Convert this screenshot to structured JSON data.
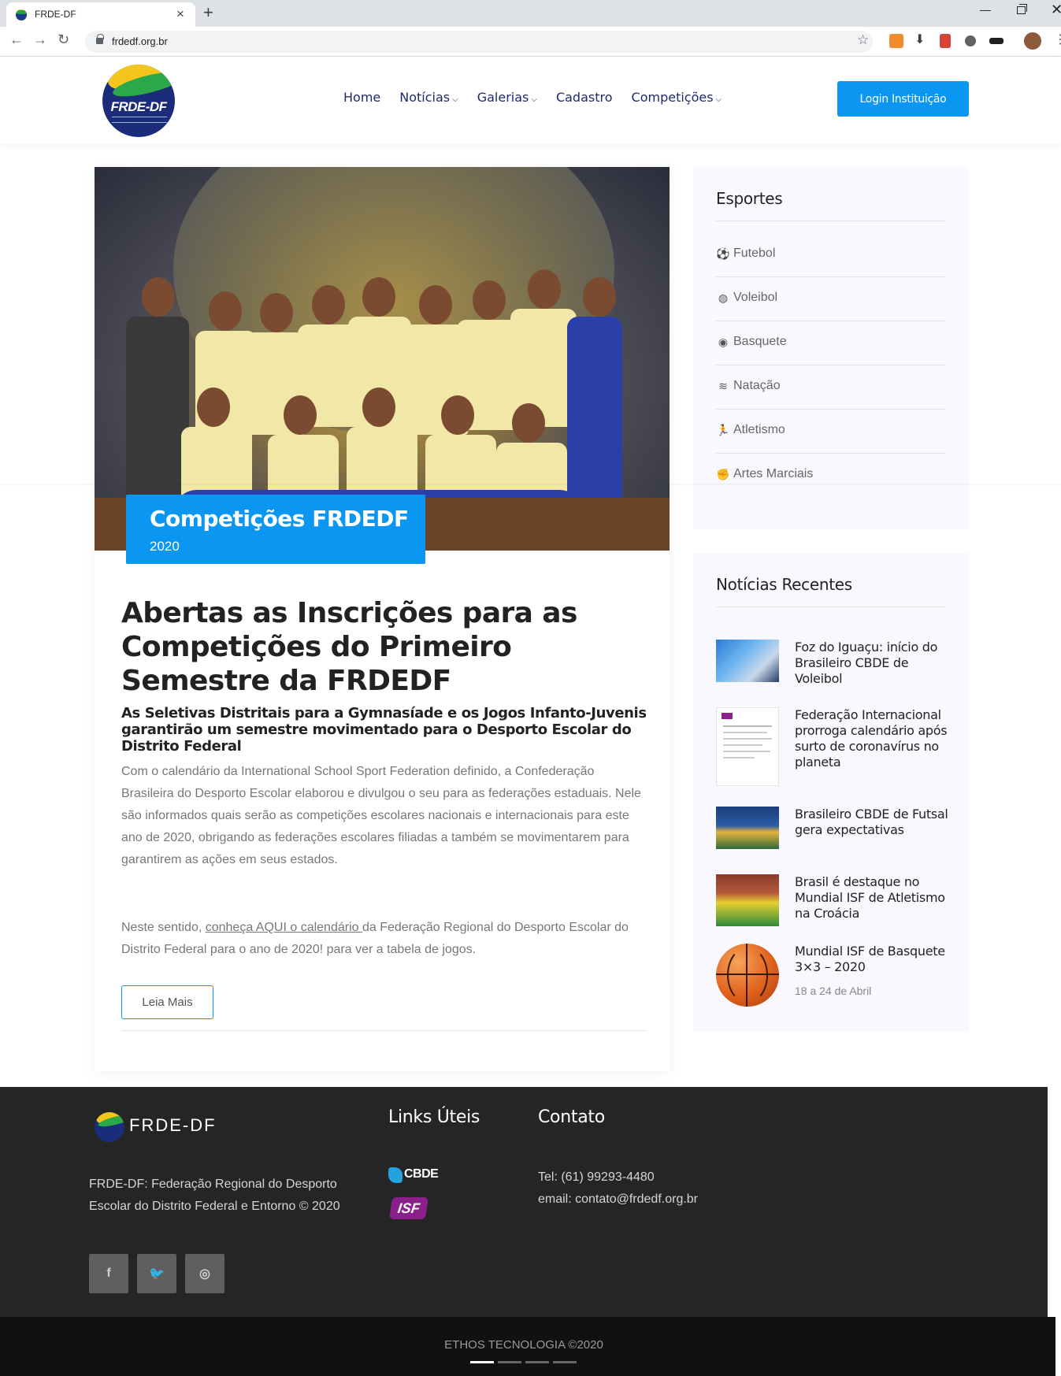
{
  "browser": {
    "tab_title": "FRDE-DF",
    "url": "frdedf.org.br"
  },
  "header": {
    "logo_text": "FRDE-DF",
    "nav": [
      {
        "label": "Home"
      },
      {
        "label": "Notícias"
      },
      {
        "label": "Galerias"
      },
      {
        "label": "Cadastro"
      },
      {
        "label": "Competições"
      }
    ],
    "login_label": "Login Instituição"
  },
  "hero": {
    "badge_title": "Competições FRDEDF",
    "badge_year": "2020"
  },
  "article": {
    "title": "Abertas as Inscrições para as Competições do Primeiro Semestre da FRDEDF",
    "subtitle": "As Seletivas Distritais para a Gymnasíade e os Jogos Infanto-Juvenis garantirão um semestre movimentado para o Desporto Escolar do Distrito Federal",
    "body": "Com o calendário da International School Sport Federation definido, a Confederação Brasileira do Desporto Escolar elaborou e divulgou o seu para as federações estaduais. Nele são informados quais serão as competições escolares nacionais e internacionais para este ano de 2020, obrigando as federações escolares filiadas a também se movimentarem para garantirem as ações em seus estados.",
    "body2_prefix": "Neste sentido, ",
    "body2_link": "conheça AQUI o calendário ",
    "body2_suffix": "da Federação Regional do Desporto Escolar do Distrito Federal para o ano de 2020! para ver a tabela de jogos.",
    "read_more": "Leia Mais"
  },
  "sidebar": {
    "sports_title": "Esportes",
    "sports": [
      {
        "label": "Futebol",
        "icon": "soccer-ball-icon"
      },
      {
        "label": "Voleibol",
        "icon": "volleyball-icon"
      },
      {
        "label": "Basquete",
        "icon": "basketball-icon"
      },
      {
        "label": "Natação",
        "icon": "swimmer-icon"
      },
      {
        "label": "Atletismo",
        "icon": "runner-icon"
      },
      {
        "label": "Artes Marciais",
        "icon": "fist-icon"
      }
    ],
    "news_title": "Notícias Recentes",
    "news": [
      {
        "title": "Foz do Iguaçu: início do Brasileiro CBDE de Voleibol"
      },
      {
        "title": "Federação Internacional prorroga calendário após surto de coronavírus no planeta"
      },
      {
        "title": "Brasileiro CBDE de Futsal gera expectativas"
      },
      {
        "title": "Brasil é destaque no Mundial ISF de Atletismo na Croácia"
      },
      {
        "title": "Mundial ISF de Basquete 3×3 – 2020",
        "date": "18 a 24 de Abril"
      }
    ]
  },
  "footer": {
    "brand": "FRDE-DF",
    "about": "FRDE-DF: Federação Regional do Desporto Escolar do Distrito Federal e Entorno © 2020",
    "links_title": "Links Úteis",
    "cbde_label": "CBDE",
    "isf_label": "ISF",
    "contact_title": "Contato",
    "phone": "Tel: (61) 99293-4480",
    "email": "email: contato@frdedf.org.br",
    "social": [
      {
        "label": "f",
        "icon": "facebook-icon"
      },
      {
        "label": "🐦",
        "icon": "twitter-icon"
      },
      {
        "label": "◎",
        "icon": "instagram-icon"
      }
    ],
    "copyright": "ETHOS TECNOLOGIA ©2020"
  },
  "colors": {
    "accent": "#0b96f2",
    "nav_text": "#1f2a6b",
    "footer_bg": "#252525"
  }
}
